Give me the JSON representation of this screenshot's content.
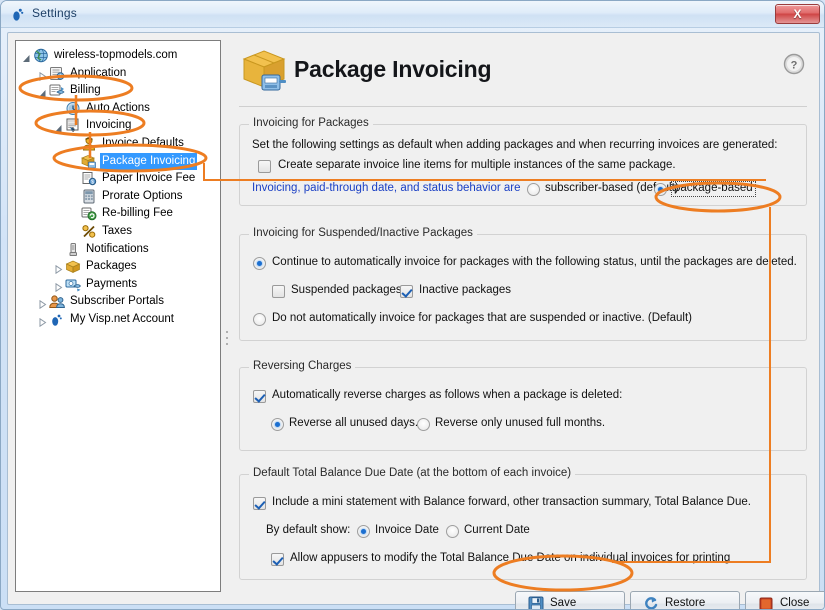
{
  "window": {
    "title": "Settings",
    "title_icon": "visp-foot-icon",
    "close_label": "X"
  },
  "tree": {
    "items": [
      {
        "label": "wireless-topmodels.com",
        "depth": 0,
        "twisty": "expanded",
        "icon": "globe-icon",
        "selected": false
      },
      {
        "label": "Application",
        "depth": 1,
        "twisty": "collapsed",
        "icon": "application-icon",
        "selected": false
      },
      {
        "label": "Billing",
        "depth": 1,
        "twisty": "expanded",
        "icon": "billing-icon",
        "selected": false
      },
      {
        "label": "Auto Actions",
        "depth": 2,
        "twisty": "none",
        "icon": "clock-icon",
        "selected": false
      },
      {
        "label": "Invoicing",
        "depth": 2,
        "twisty": "expanded",
        "icon": "invoice-icon",
        "selected": false
      },
      {
        "label": "Invoice Defaults",
        "depth": 3,
        "twisty": "none",
        "icon": "person-gold-icon",
        "selected": false
      },
      {
        "label": "Package Invoicing",
        "depth": 3,
        "twisty": "none",
        "icon": "package-invoice-icon",
        "selected": true
      },
      {
        "label": "Paper Invoice Fee",
        "depth": 3,
        "twisty": "none",
        "icon": "paper-fee-icon",
        "selected": false
      },
      {
        "label": "Prorate Options",
        "depth": 3,
        "twisty": "none",
        "icon": "prorate-icon",
        "selected": false
      },
      {
        "label": "Re-billing Fee",
        "depth": 3,
        "twisty": "none",
        "icon": "rebilling-icon",
        "selected": false
      },
      {
        "label": "Taxes",
        "depth": 3,
        "twisty": "none",
        "icon": "percent-icon",
        "selected": false
      },
      {
        "label": "Notifications",
        "depth": 2,
        "twisty": "none",
        "icon": "notification-icon",
        "selected": false
      },
      {
        "label": "Packages",
        "depth": 2,
        "twisty": "collapsed",
        "icon": "packages-icon",
        "selected": false
      },
      {
        "label": "Payments",
        "depth": 2,
        "twisty": "collapsed",
        "icon": "payments-icon",
        "selected": false
      },
      {
        "label": "Subscriber Portals",
        "depth": 1,
        "twisty": "collapsed",
        "icon": "subscribers-icon",
        "selected": false
      },
      {
        "label": "My Visp.net Account",
        "depth": 1,
        "twisty": "collapsed",
        "icon": "visp-foot-icon",
        "selected": false
      }
    ]
  },
  "page": {
    "title": "Package Invoicing",
    "header_icon": "package-invoice-large-icon",
    "help_icon": "help-question-icon"
  },
  "groups": {
    "invoicing_for_packages": {
      "title": "Invoicing for Packages",
      "intro": "Set the following settings as default when adding packages and when recurring invoices are generated:",
      "separate_line_items": {
        "label": "Create separate invoice line items for multiple instances of the same package.",
        "checked": false
      },
      "behavior_label": "Invoicing, paid-through date, and status behavior are",
      "behavior_options": [
        {
          "label": "subscriber-based (default)",
          "selected": false
        },
        {
          "label": "package-based",
          "selected": true,
          "focused": true
        }
      ]
    },
    "suspended_inactive": {
      "title": "Invoicing for Suspended/Inactive Packages",
      "option_continue": {
        "label": "Continue to automatically invoice for packages with the following status, until the packages are deleted.",
        "selected": true
      },
      "checkboxes": [
        {
          "label": "Suspended packages",
          "checked": false
        },
        {
          "label": "Inactive packages",
          "checked": true
        }
      ],
      "option_stop": {
        "label": "Do not automatically invoice for packages that are suspended or inactive. (Default)",
        "selected": false
      }
    },
    "reversing_charges": {
      "title": "Reversing Charges",
      "auto_reverse": {
        "label": "Automatically reverse charges as follows when a package is deleted:",
        "checked": true
      },
      "options": [
        {
          "label": "Reverse all unused days.",
          "selected": true
        },
        {
          "label": "Reverse only unused full months.",
          "selected": false
        }
      ]
    },
    "balance_due": {
      "title": "Default Total Balance Due Date (at the bottom of each invoice)",
      "mini_statement": {
        "label": "Include a mini statement with Balance forward, other transaction summary, Total Balance Due.",
        "checked": true
      },
      "by_default_show_label": "By default show:",
      "date_options": [
        {
          "label": "Invoice Date",
          "selected": true
        },
        {
          "label": "Current Date",
          "selected": false
        }
      ],
      "allow_modify": {
        "label": "Allow appusers to modify the Total Balance Due Date on individual invoices for printing",
        "checked": true
      }
    }
  },
  "footer": {
    "buttons": [
      {
        "label": "Save",
        "icon": "floppy-disk-icon"
      },
      {
        "label": "Restore",
        "icon": "restore-arrow-icon"
      },
      {
        "label": "Close",
        "icon": "close-square-icon"
      }
    ]
  },
  "annotations": {
    "color": "#ED7D22",
    "highlights": [
      "billing-tree-item",
      "invoicing-tree-item",
      "package-invoicing-tree-item",
      "package-based-radio",
      "save-button"
    ]
  },
  "colors": {
    "accent_orange": "#ED7D22",
    "selection_blue": "#3399FF",
    "link_blue": "#1A3FC4",
    "window_bg": "#F0F0F0"
  }
}
